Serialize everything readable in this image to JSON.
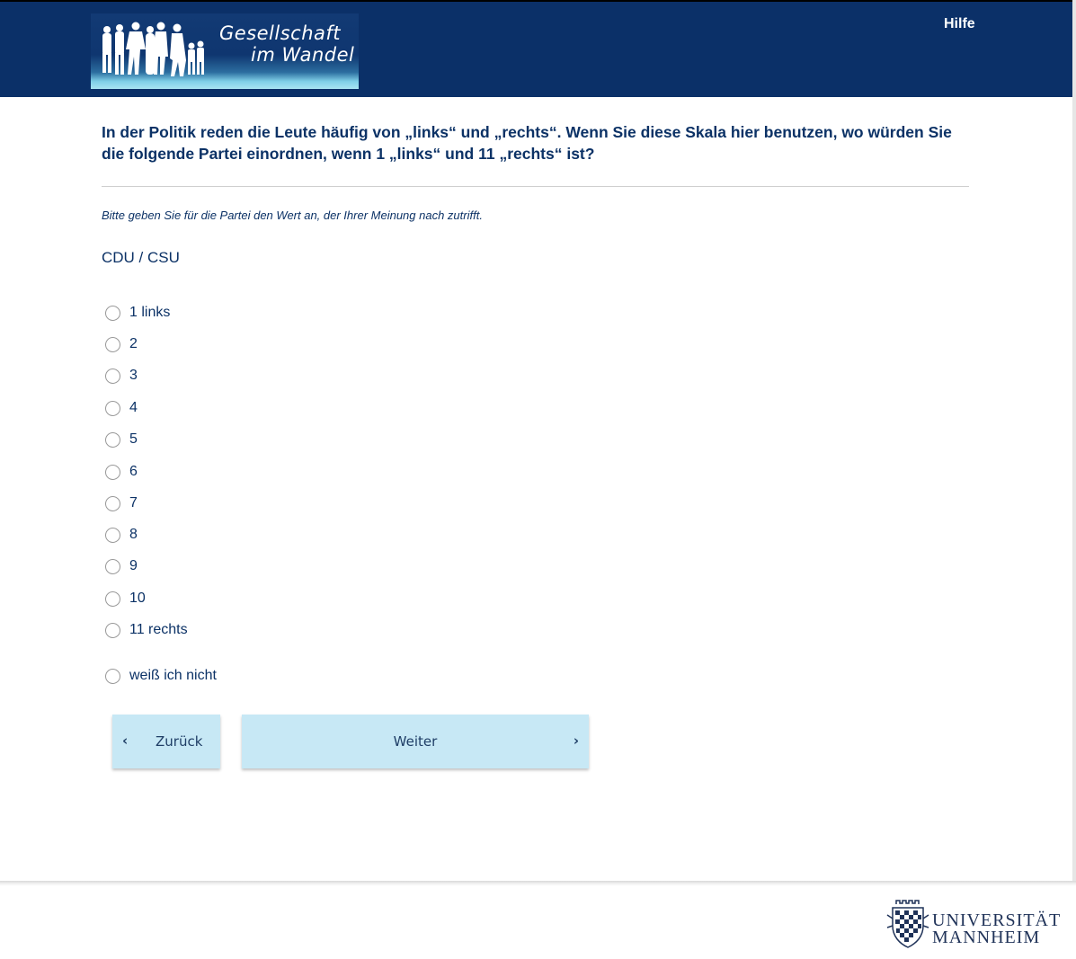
{
  "header": {
    "logo_line1": "Gesellschaft",
    "logo_line2": "im Wandel",
    "help_label": "Hilfe"
  },
  "question": {
    "text": "In der Politik reden die Leute häufig von „links“ und „rechts“. Wenn Sie diese Skala hier benutzen, wo würden Sie die folgende Partei einordnen, wenn 1 „links“ und 11 „rechts“ ist?",
    "instruction": "Bitte geben Sie für die Partei den Wert an, der Ihrer Meinung nach zutrifft.",
    "party": "CDU / CSU"
  },
  "options": [
    {
      "label": "1 links"
    },
    {
      "label": "2"
    },
    {
      "label": "3"
    },
    {
      "label": "4"
    },
    {
      "label": "5"
    },
    {
      "label": "6"
    },
    {
      "label": "7"
    },
    {
      "label": "8"
    },
    {
      "label": "9"
    },
    {
      "label": "10"
    },
    {
      "label": "11 rechts"
    },
    {
      "label": "weiß ich nicht"
    }
  ],
  "nav": {
    "back_label": "Zurück",
    "next_label": "Weiter",
    "back_icon": "chevron-left-icon",
    "next_icon": "chevron-right-icon"
  },
  "footer": {
    "uni_line1": "UNIVERSITÄT",
    "uni_line2": "MANNHEIM"
  },
  "colors": {
    "header_bg": "#0b3068",
    "text": "#0c3266",
    "button_bg": "#c7e8f5"
  }
}
